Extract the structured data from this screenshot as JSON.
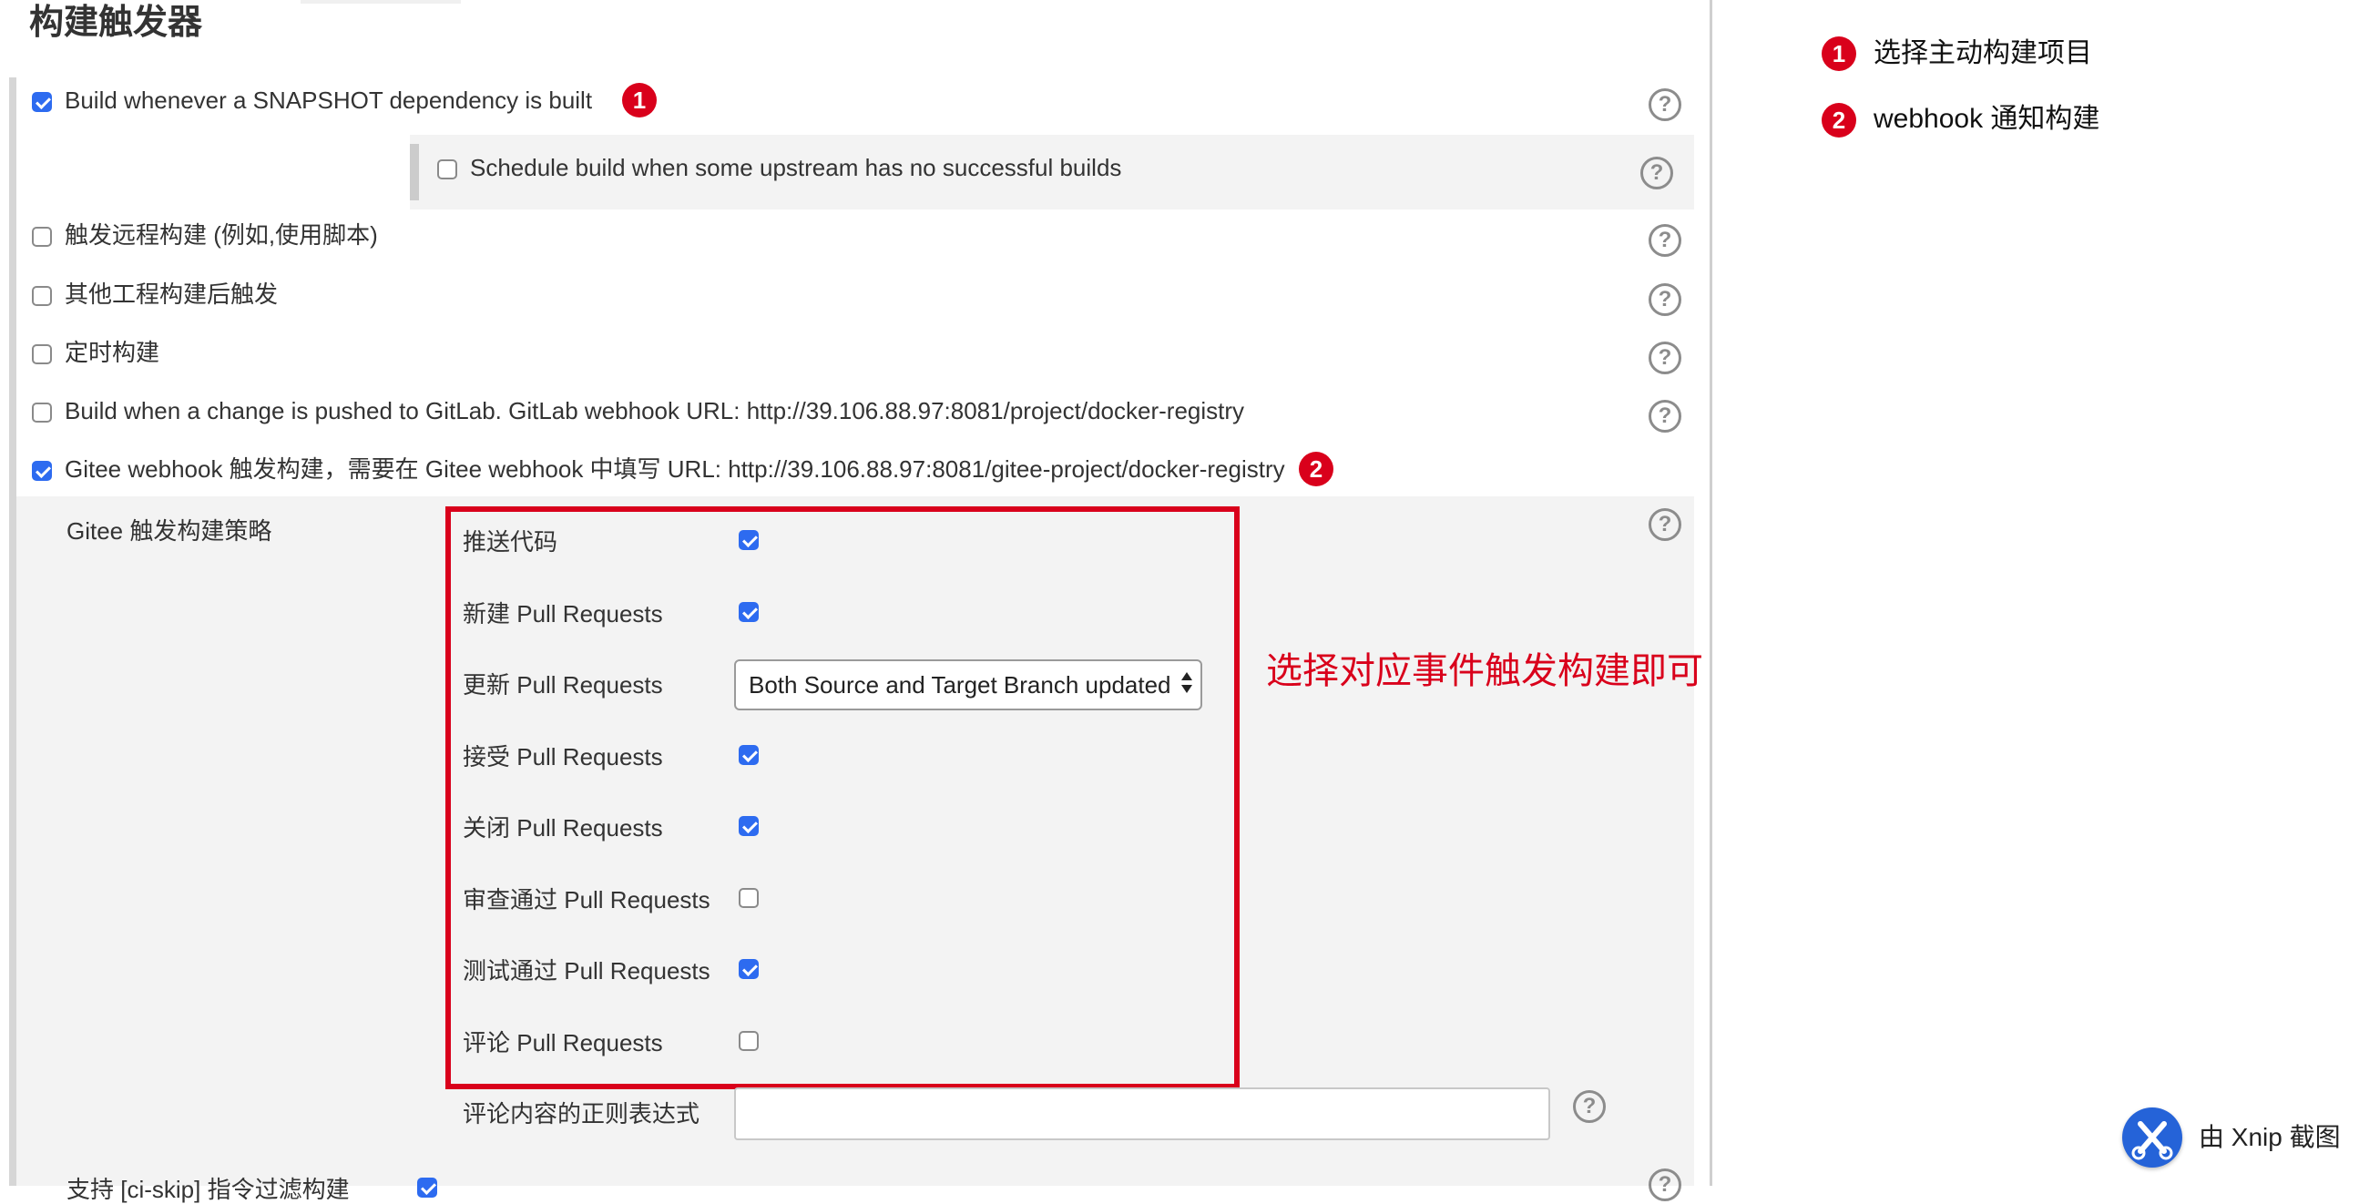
{
  "section": {
    "title": "构建触发器"
  },
  "triggers": {
    "snapshot": {
      "label": "Build whenever a SNAPSHOT dependency is built",
      "checked": true,
      "badge": "1"
    },
    "upstream": {
      "label": "Schedule build when some upstream has no successful builds",
      "checked": false
    },
    "remote": {
      "label": "触发远程构建 (例如,使用脚本)",
      "checked": false
    },
    "after_other": {
      "label": "其他工程构建后触发",
      "checked": false
    },
    "periodic": {
      "label": "定时构建",
      "checked": false
    },
    "gitlab": {
      "label": "Build when a change is pushed to GitLab. GitLab webhook URL: http://39.106.88.97:8081/project/docker-registry",
      "checked": false
    },
    "gitee": {
      "label": "Gitee webhook 触发构建，需要在 Gitee webhook 中填写 URL: http://39.106.88.97:8081/gitee-project/docker-registry",
      "checked": true,
      "badge": "2"
    }
  },
  "gitee_strategy": {
    "label": "Gitee 触发构建策略",
    "items": [
      {
        "label": "推送代码",
        "checked": true
      },
      {
        "label": "新建 Pull Requests",
        "checked": true
      },
      {
        "label": "更新 Pull Requests",
        "select_value": "Both Source and Target Branch updated"
      },
      {
        "label": "接受 Pull Requests",
        "checked": true
      },
      {
        "label": "关闭 Pull Requests",
        "checked": true
      },
      {
        "label": "审查通过 Pull Requests",
        "checked": false
      },
      {
        "label": "测试通过 Pull Requests",
        "checked": true
      },
      {
        "label": "评论 Pull Requests",
        "checked": false
      }
    ],
    "regex_label": "评论内容的正则表达式",
    "regex_value": "",
    "ci_skip_label": "支持 [ci-skip] 指令过滤构建",
    "ci_skip_checked": true
  },
  "annotation": {
    "text": "选择对应事件触发构建即可",
    "color": "#d9001b"
  },
  "legend": [
    {
      "badge": "1",
      "text": "选择主动构建项目"
    },
    {
      "badge": "2",
      "text": "webhook 通知构建"
    }
  ],
  "help_glyph": "?",
  "watermark": {
    "text": "由 Xnip 截图"
  },
  "colors": {
    "checkbox": "#2d6bf0",
    "badge": "#d9001b",
    "highlight_box": "#d9001b"
  }
}
